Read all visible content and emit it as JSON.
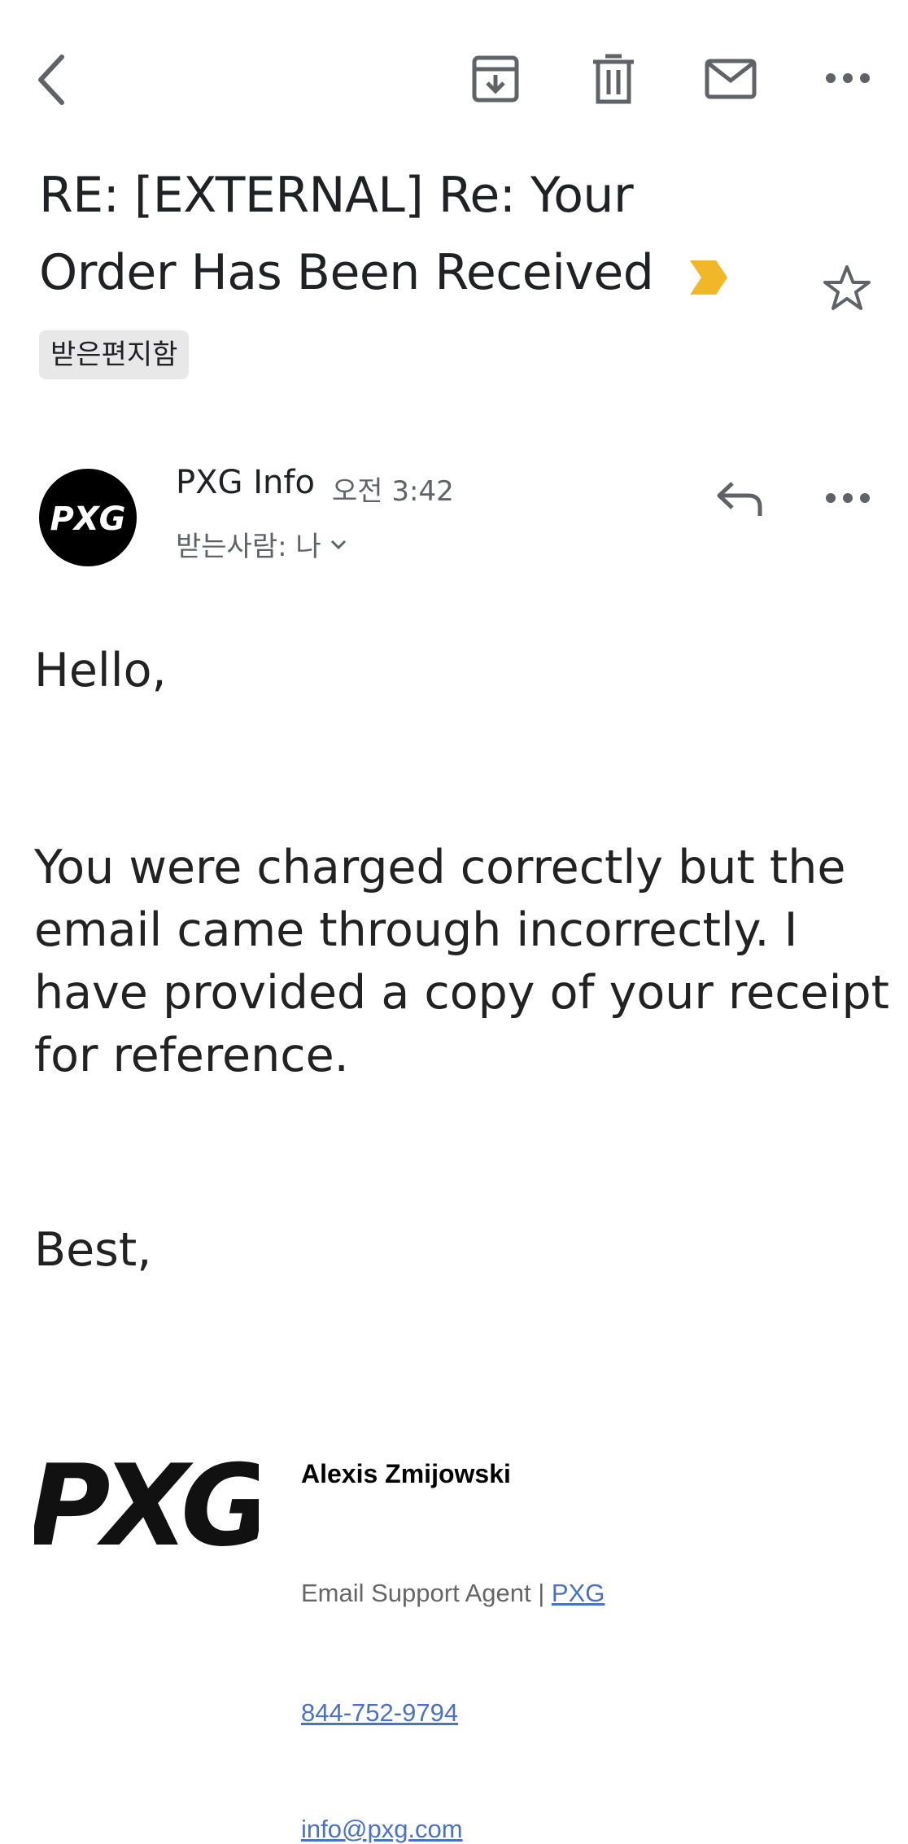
{
  "toolbar": {
    "back_icon": "back-arrow-icon",
    "archive_icon": "archive-icon",
    "delete_icon": "trash-icon",
    "mark_unread_icon": "mail-icon",
    "more_icon": "more-horizontal-icon"
  },
  "email": {
    "subject_line1": "RE: [EXTERNAL] Re: Your",
    "subject_line2": "Order Has Been Received",
    "importance_color": "#f2b629",
    "label": "받은편지함",
    "sender": {
      "name": "PXG Info",
      "time": "오전 3:42",
      "recipients": "받는사람: 나",
      "avatar_text": "PXG"
    },
    "body": {
      "greeting": "Hello,",
      "paragraph_lines": [
        "You were charged correctly but the",
        "email came through incorrectly. I",
        "have provided a copy of your receipt",
        "for reference."
      ],
      "closing": "Best,"
    },
    "signature": {
      "logo_text": "PXG",
      "name": "Alexis Zmijowski",
      "title_prefix": "Email Support Agent | ",
      "company_link": "PXG",
      "phone": "844-752-9794",
      "email": "info@pxg.com"
    }
  },
  "colors": {
    "text": "#202124",
    "secondary": "#5f6368",
    "link": "#4a72c4",
    "icon": "#5f6368"
  }
}
